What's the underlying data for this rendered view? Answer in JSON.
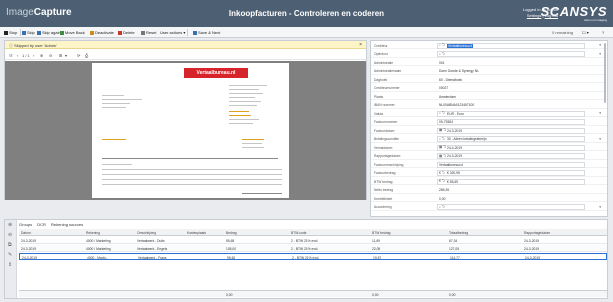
{
  "header": {
    "logo_part1": "Image",
    "logo_part2": "Capture",
    "title": "Inkoopfacturen - Controleren en coderen",
    "logged_in": "Logged in as Admin",
    "settings_link": "Settings",
    "separator": "|",
    "logout_link": "Log out",
    "brand": "SCANSYS",
    "brand_tagline": "vision on imaging"
  },
  "toolbar": {
    "items": [
      {
        "label": "Stop",
        "name": "stop-button",
        "icon": "stop-icon",
        "color": "#222222"
      },
      {
        "label": "Skip",
        "name": "skip-button",
        "icon": "skip-icon",
        "color": "#3a6fb0"
      },
      {
        "label": "Skip again",
        "name": "skip-again-button",
        "icon": "skip-again-icon",
        "color": "#3a6fb0"
      },
      {
        "label": "Move Back",
        "name": "move-back-button",
        "icon": "move-back-icon",
        "color": "#3a8f3a"
      },
      {
        "label": "Deactivate",
        "name": "deactivate-button",
        "icon": "deactivate-icon",
        "color": "#d08a1c"
      },
      {
        "label": "Delete",
        "name": "delete-button",
        "icon": "delete-icon",
        "color": "#c0392b"
      },
      {
        "label": "Reset",
        "name": "reset-button",
        "icon": "reset-icon",
        "color": "#777777"
      },
      {
        "label": "User actions ▾",
        "name": "user-actions-menu",
        "icon": "",
        "color": ""
      },
      {
        "label": "Save & Next",
        "name": "save-next-button",
        "icon": "save-icon",
        "color": "#3a6fb0"
      }
    ],
    "remaining": "0 remaining"
  },
  "document": {
    "notice": "Skipped by user 'Admin'",
    "page_indicator": "1 / 1",
    "banner_text": "Vertaalbureau.nl"
  },
  "fields": [
    {
      "label": "Crediteur",
      "value": "Vertaalbureau.nl",
      "highlight": true,
      "icon": "search-icon",
      "dropdown": true,
      "input": true
    },
    {
      "label": "Opdrdoor",
      "value": "",
      "icon": "search-icon",
      "dropdown": true,
      "input": true
    },
    {
      "label": "Administratie",
      "value": "001"
    },
    {
      "label": "Administratienaam",
      "value": "Doen Goede & Synergy NL"
    },
    {
      "label": "Dagboek",
      "value": "60 - Dienstboek"
    },
    {
      "label": "Crediteurnummer",
      "value": "00027"
    },
    {
      "label": "Plaats",
      "value": "Amsterdam"
    },
    {
      "label": "IBAN nummer",
      "value": "NL00ABNA0123457100"
    },
    {
      "label": "Valuta",
      "value": "EUR - Euro",
      "icon": "search-icon",
      "dropdown": true,
      "input": true
    },
    {
      "label": "Factuurnummer",
      "value": "09-75384",
      "input": true
    },
    {
      "label": "Factuurdatum",
      "value": "24-3-2019",
      "icon": "calendar-icon",
      "input": true
    },
    {
      "label": "Betalingsconditie",
      "value": "30 - Alleen betalingstermijn",
      "icon": "search-icon",
      "dropdown": true,
      "input": true
    },
    {
      "label": "Vervaldatum",
      "value": "24-4-2019",
      "icon": "calendar-icon",
      "input": true
    },
    {
      "label": "Rapportagedatum",
      "value": "24-3-2019",
      "icon": "calendar-icon",
      "input": true
    },
    {
      "label": "Factuuromschrijving",
      "value": "Vertaalbureau.nl",
      "input": true
    },
    {
      "label": "Factuurbedrag",
      "value": "€ 320,95",
      "icon": "money-icon",
      "input": true
    },
    {
      "label": "BTW bedrag",
      "value": "€ 55,69",
      "icon": "money-icon",
      "input": true
    },
    {
      "label": "Netto bedrag",
      "value": "265,26"
    },
    {
      "label": "Kredietlimiet",
      "value": "0,00"
    },
    {
      "label": "Accordering",
      "value": "",
      "icon": "search-icon",
      "dropdown": true,
      "input": true
    }
  ],
  "bottom": {
    "tabs": [
      "Groups",
      "DCR",
      "Rekening sources"
    ],
    "columns": [
      "Datum",
      "Rekening",
      "Omschrijving",
      "Kostenplaats",
      "Bedrag",
      "BTW-code",
      "BTW bedrag",
      "Totaalbedrag",
      "Rapportagedatum"
    ],
    "rows": [
      [
        "24-3-2019",
        "4000 / Marketing",
        "Vertaalwerk - Duits",
        "",
        "55,65",
        "2 - BTW 21% excl.",
        "11,69",
        "67,34",
        "24-3-2019"
      ],
      [
        "24-3-2019",
        "4000 / Marketing",
        "Vertaalwerk - Engels",
        "",
        "105,00",
        "2 - BTW 21% excl.",
        "22,05",
        "127,05",
        "24-3-2019"
      ],
      [
        "24-3-2019",
        "4000 - Markt...",
        "Vertaalwerk - Frans",
        "",
        "95,60",
        "2 - BTW 21% excl.",
        "19,57",
        "114,77",
        "24-3-2019"
      ]
    ],
    "totals": [
      "0,00",
      "0,00",
      "0,00"
    ]
  }
}
